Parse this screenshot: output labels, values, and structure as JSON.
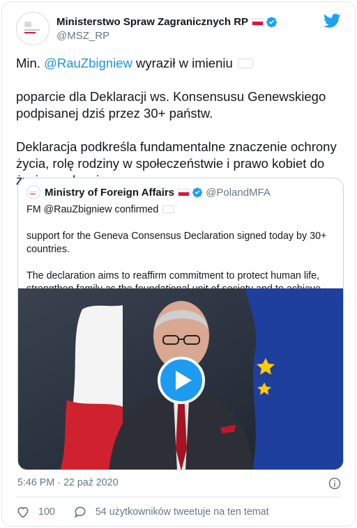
{
  "author": {
    "name": "Ministerstwo Spraw Zagranicznych RP",
    "handle": "@MSZ_RP"
  },
  "tweet": {
    "p1_before": "Min. ",
    "p1_mention": "@RauZbigniew",
    "p1_mid": " wyraził w imieniu ",
    "p1_after": " poparcie dla Deklaracji ws. Konsensusu Genewskiego podpisanej dziś przez 30+ państw.",
    "p2": "Deklaracja podkreśla fundamentalne znaczenie ochrony życia, rolę rodziny w społeczeństwie i prawo kobiet do życia w zdrowiu."
  },
  "quote": {
    "name": "Ministry of Foreign Affairs",
    "handle": "@PolandMFA",
    "p1_before": "FM @RauZbigniew confirmed ",
    "p1_after": " support for the Geneva Consensus Declaration signed today by 30+ countries.",
    "p2": "The declaration aims to reaffirm commitment to protect human life, strengthen family as the foundational unit of society and to achieve better health for women."
  },
  "meta": {
    "timestamp": "5:46 PM · 22 paź 2020"
  },
  "actions": {
    "likes": "100",
    "retweet_text": "54 użytkowników tweetuje na ten temat"
  },
  "colors": {
    "accent": "#1da1f2",
    "mention": "#1b95e0",
    "flag_red": "#dc143c",
    "secondary_text": "#657786"
  }
}
